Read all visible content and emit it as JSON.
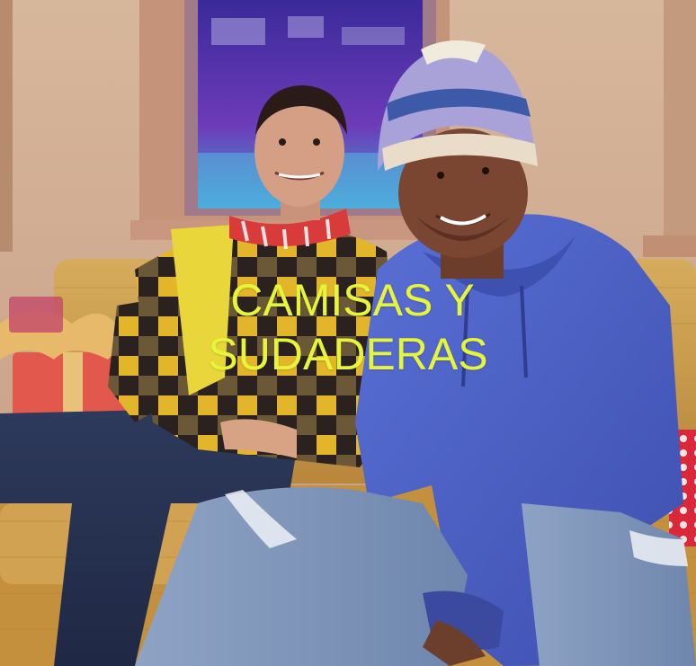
{
  "banner": {
    "headline_line1": "CAMISAS Y",
    "headline_line2": "SUDADERAS"
  },
  "colors": {
    "headline": "#e6f53a",
    "wall": "#d8b9a0",
    "sofa": "#c99a4a",
    "hoodie": "#4d63c8",
    "jeans": "#7d93b6"
  }
}
